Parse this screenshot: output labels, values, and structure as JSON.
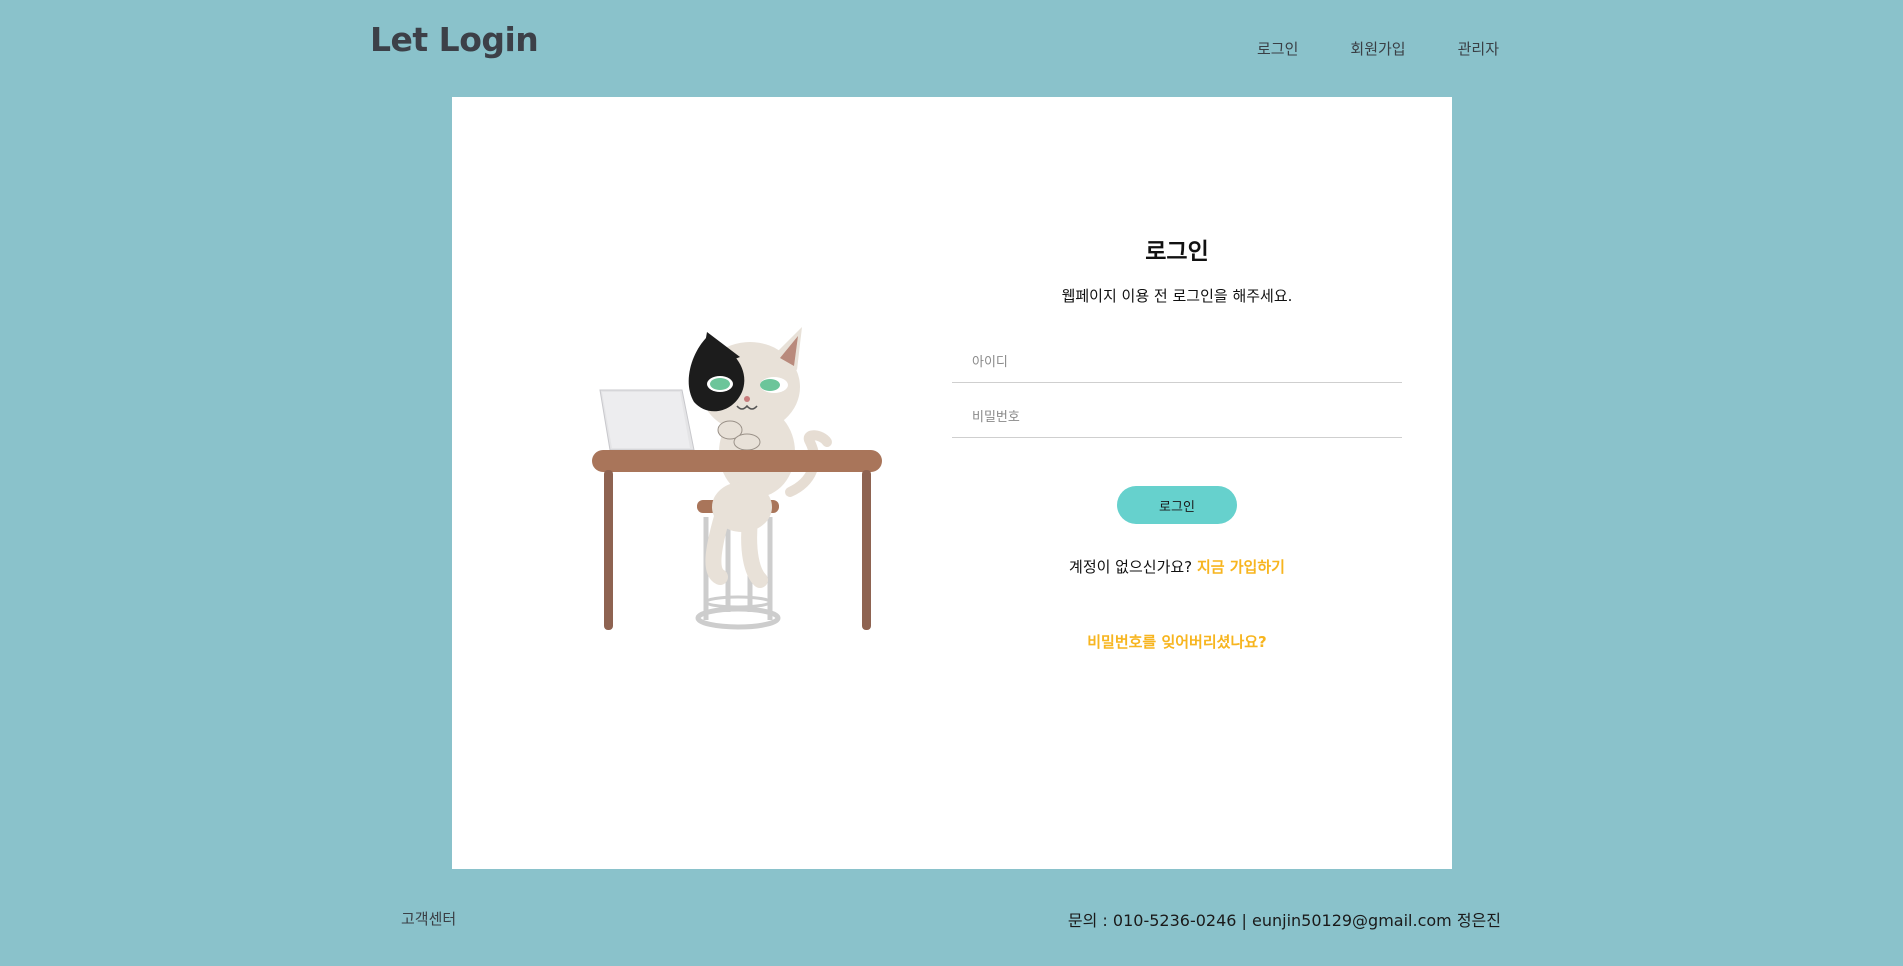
{
  "header": {
    "logo": "Let Login",
    "nav": [
      "로그인",
      "회원가입",
      "관리자"
    ]
  },
  "login": {
    "title": "로그인",
    "subtitle": "웹페이지 이용 전 로그인을 해주세요.",
    "id_placeholder": "아이디",
    "pw_placeholder": "비밀번호",
    "button_label": "로그인",
    "signup_prompt": "계정이 없으신가요?",
    "signup_link": "지금 가입하기",
    "forgot_link": "비밀번호를 잊어버리셨나요?"
  },
  "illustration": {
    "icon": "cat-at-desk-illustration"
  },
  "footer": {
    "left": "고객센터",
    "contact": "문의 : 010-5236-0246 | eunjin50129@gmail.com 정은진"
  },
  "colors": {
    "background": "#8ac2cb",
    "button": "#66d1cd",
    "accent": "#f7b51f",
    "card": "#ffffff"
  }
}
